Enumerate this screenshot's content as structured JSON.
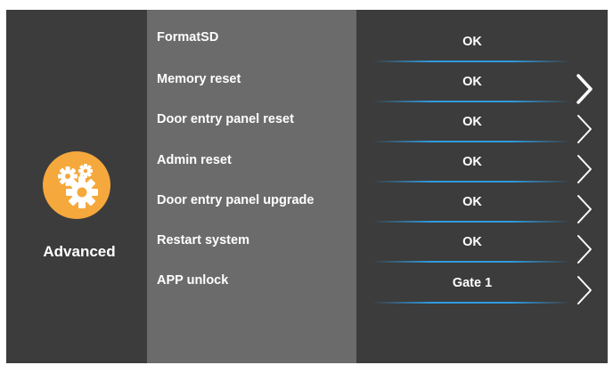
{
  "category": {
    "label": "Advanced",
    "icon": "gears-icon",
    "accent_color": "#f5a83c"
  },
  "settings": [
    {
      "label": "FormatSD",
      "value": "OK",
      "has_arrow": false
    },
    {
      "label": "Memory reset",
      "value": "OK",
      "has_arrow": true
    },
    {
      "label": "Door entry panel reset",
      "value": "OK",
      "has_arrow": true
    },
    {
      "label": "Admin reset",
      "value": "OK",
      "has_arrow": true
    },
    {
      "label": "Door entry panel upgrade",
      "value": "OK",
      "has_arrow": true
    },
    {
      "label": "Restart system",
      "value": "OK",
      "has_arrow": true
    },
    {
      "label": "APP unlock",
      "value": "Gate 1",
      "has_arrow": true
    }
  ],
  "colors": {
    "background": "#3c3c3c",
    "labels_panel": "#6b6b6b",
    "underline": "#2e9be0"
  }
}
